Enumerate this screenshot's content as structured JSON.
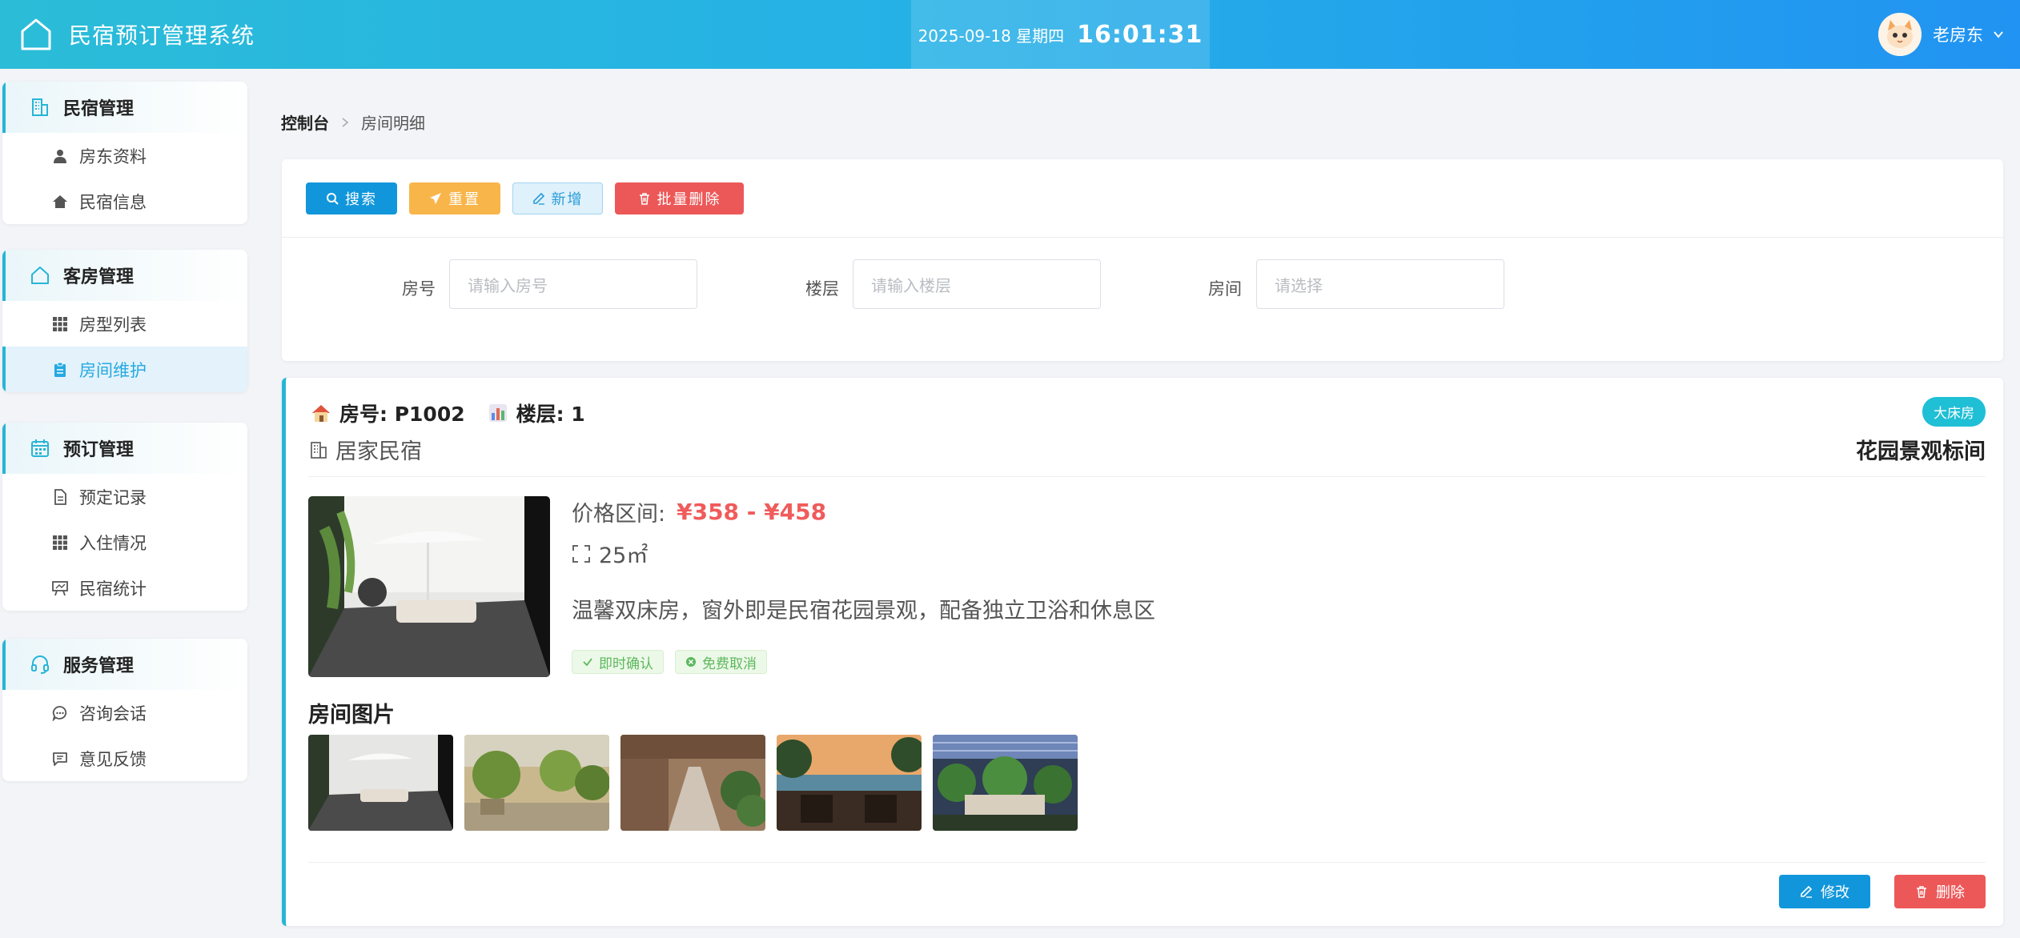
{
  "header": {
    "title": "民宿预订管理系统",
    "date": "2025-09-18 星期四",
    "time": "16:01:31",
    "user": "老房东"
  },
  "sidebar": {
    "groups": [
      {
        "label": "民宿管理",
        "icon": "building-icon",
        "items": [
          {
            "label": "房东资料",
            "icon": "person-icon"
          },
          {
            "label": "民宿信息",
            "icon": "home-icon"
          }
        ]
      },
      {
        "label": "客房管理",
        "icon": "home-outline-icon",
        "items": [
          {
            "label": "房型列表",
            "icon": "grid-icon"
          },
          {
            "label": "房间维护",
            "icon": "clipboard-icon",
            "active": true
          }
        ]
      },
      {
        "label": "预订管理",
        "icon": "calendar-icon",
        "items": [
          {
            "label": "预定记录",
            "icon": "document-icon"
          },
          {
            "label": "入住情况",
            "icon": "grid-icon"
          },
          {
            "label": "民宿统计",
            "icon": "chart-board-icon"
          }
        ]
      },
      {
        "label": "服务管理",
        "icon": "headset-icon",
        "items": [
          {
            "label": "咨询会话",
            "icon": "chat-icon"
          },
          {
            "label": "意见反馈",
            "icon": "message-icon"
          }
        ]
      }
    ]
  },
  "breadcrumb": {
    "home": "控制台",
    "current": "房间明细"
  },
  "toolbar": {
    "search": "搜索",
    "reset": "重置",
    "add": "新增",
    "batch_delete": "批量删除"
  },
  "filters": {
    "room_no": {
      "label": "房号",
      "placeholder": "请输入房号"
    },
    "floor": {
      "label": "楼层",
      "placeholder": "请输入楼层"
    },
    "room": {
      "label": "房间",
      "placeholder": "请选择"
    }
  },
  "card": {
    "room_no": "房号: P1002",
    "floor": "楼层: 1",
    "type_badge": "大床房",
    "homestay": "居家民宿",
    "room_name": "花园景观标间",
    "price_label": "价格区间:",
    "price": "¥358 - ¥458",
    "area": "25㎡",
    "description": "温馨双床房，窗外即是民宿花园景观，配备独立卫浴和休息区",
    "tags": [
      "即时确认",
      "免费取消"
    ],
    "gallery_title": "房间图片",
    "edit": "修改",
    "delete": "删除"
  },
  "colors": {
    "header_start": "#2bbcd8",
    "header_end": "#2193f2",
    "accent": "#27b5d6",
    "primary": "#1296db",
    "warning": "#f8b54a",
    "danger": "#ec5858",
    "price": "#f05b5b",
    "success": "#5cb85c"
  }
}
